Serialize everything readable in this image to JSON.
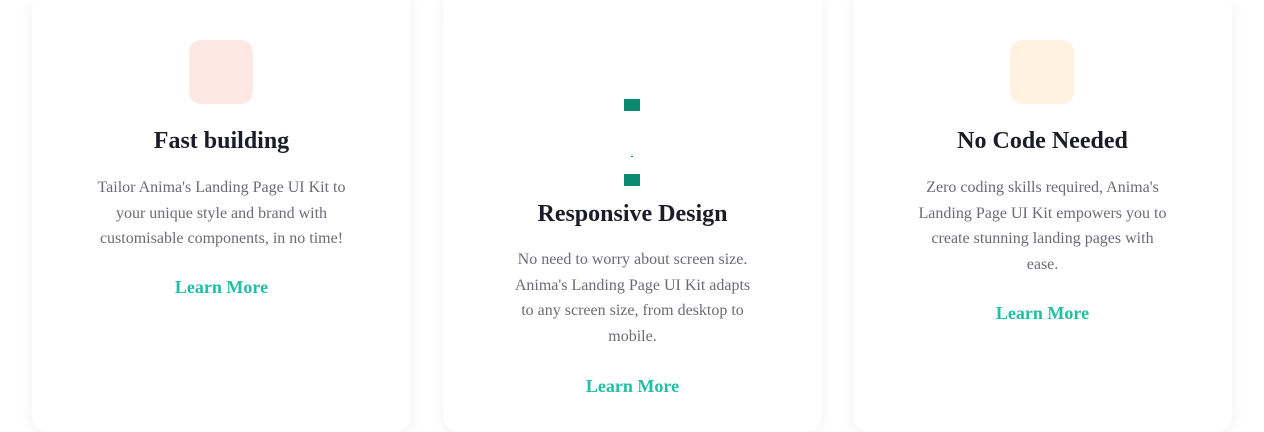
{
  "features": [
    {
      "title": "Fast building",
      "description": "Tailor Anima's Landing Page UI Kit to your unique style and brand with customisable components, in no time!",
      "link_label": "Learn More",
      "icon": "fast-building-icon",
      "icon_bg": "#ffe8e3"
    },
    {
      "title": "Responsive Design",
      "description": "No need to worry about screen size. Anima's Landing Page UI Kit adapts to any screen size, from desktop to mobile.",
      "link_label": "Learn More",
      "icon": "responsive-devices-icon",
      "icon_color": "#0b8a72"
    },
    {
      "title": "No Code Needed",
      "description": "Zero coding skills required, Anima's Landing Page UI Kit empowers you to create stunning landing pages with ease.",
      "link_label": "Learn More",
      "icon": "no-code-icon",
      "icon_bg": "#fff3e0"
    }
  ],
  "colors": {
    "accent": "#1fbfa3",
    "heading": "#1c1c28",
    "body_text": "#6b6b76"
  }
}
